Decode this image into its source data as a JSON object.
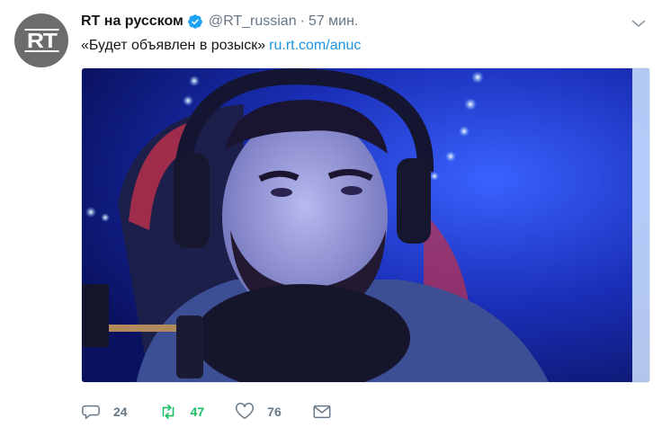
{
  "account": {
    "avatar_text": "RT",
    "display_name": "RT на русском",
    "handle": "@RT_russian",
    "separator": "·",
    "time": "57 мин."
  },
  "tweet": {
    "text": "«Будет объявлен в розыск»",
    "link": "ru.rt.com/anuc"
  },
  "actions": {
    "reply_count": "24",
    "retweet_count": "47",
    "like_count": "76"
  },
  "colors": {
    "verified": "#1da1f2",
    "link": "#1b95e0",
    "retweet_active": "#17bf63",
    "muted": "#657786"
  },
  "icons": [
    "verified-icon",
    "chevron-down-icon",
    "reply-icon",
    "retweet-icon",
    "heart-icon",
    "envelope-icon"
  ]
}
